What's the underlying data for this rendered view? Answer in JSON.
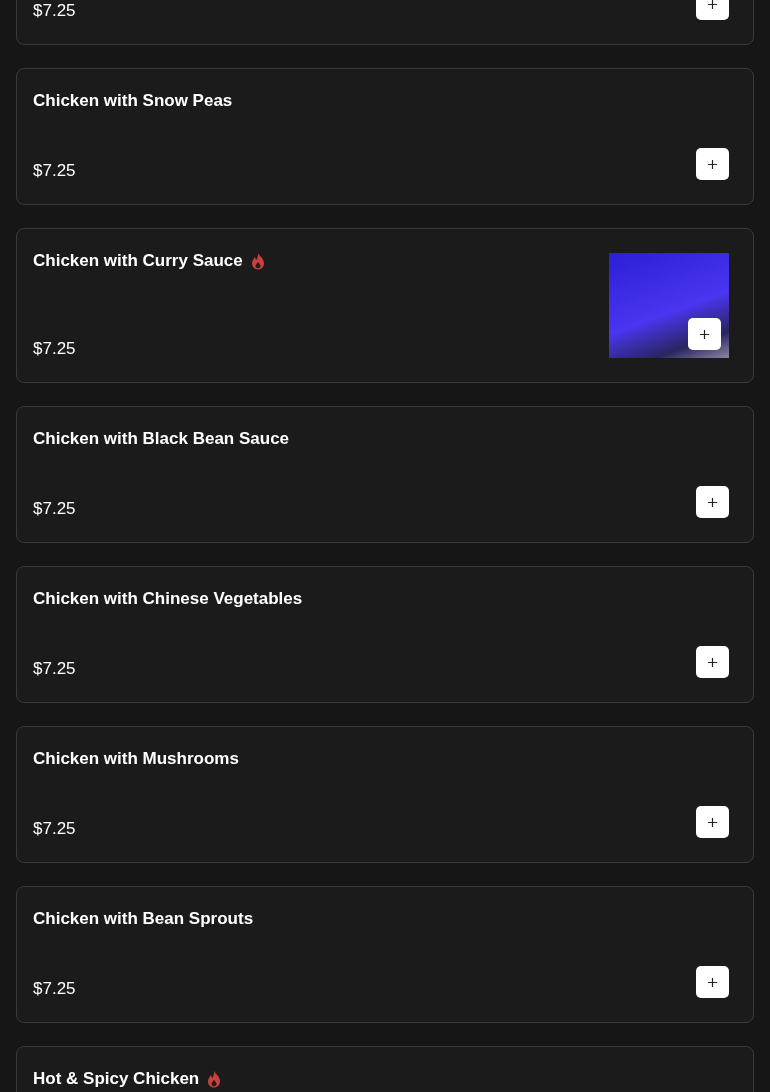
{
  "items": [
    {
      "price": "$7.25",
      "spicy": false,
      "photo": false
    },
    {
      "name": "Chicken with Snow Peas",
      "price": "$7.25",
      "spicy": false,
      "photo": false
    },
    {
      "name": "Chicken with Curry Sauce",
      "price": "$7.25",
      "spicy": true,
      "photo": true
    },
    {
      "name": "Chicken with Black Bean Sauce",
      "price": "$7.25",
      "spicy": false,
      "photo": false
    },
    {
      "name": "Chicken with Chinese Vegetables",
      "price": "$7.25",
      "spicy": false,
      "photo": false
    },
    {
      "name": "Chicken with Mushrooms",
      "price": "$7.25",
      "spicy": false,
      "photo": false
    },
    {
      "name": "Chicken with Bean Sprouts",
      "price": "$7.25",
      "spicy": false,
      "photo": false
    },
    {
      "name": "Hot & Spicy Chicken",
      "spicy": true,
      "photo": false
    }
  ]
}
